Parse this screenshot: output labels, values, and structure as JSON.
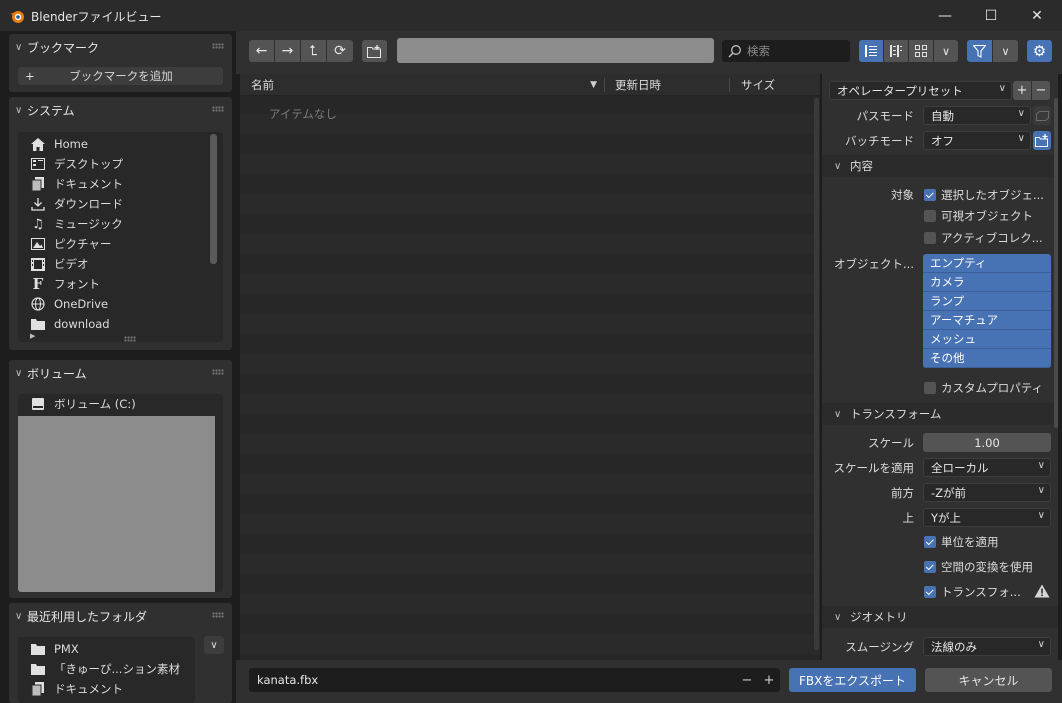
{
  "window": {
    "title": "Blenderファイルビュー",
    "minimize": "—",
    "maximize": "☐",
    "close": "✕"
  },
  "sidebar": {
    "bookmarks": {
      "header": "ブックマーク",
      "add_label": "ブックマークを追加"
    },
    "system": {
      "header": "システム",
      "items": [
        {
          "label": "Home",
          "icon": "home-icon"
        },
        {
          "label": "デスクトップ",
          "icon": "desktop-icon"
        },
        {
          "label": "ドキュメント",
          "icon": "documents-icon"
        },
        {
          "label": "ダウンロード",
          "icon": "download-icon"
        },
        {
          "label": "ミュージック",
          "icon": "music-icon"
        },
        {
          "label": "ピクチャー",
          "icon": "pictures-icon"
        },
        {
          "label": "ビデオ",
          "icon": "video-icon"
        },
        {
          "label": "フォント",
          "icon": "font-icon"
        },
        {
          "label": "OneDrive",
          "icon": "globe-icon"
        },
        {
          "label": "download",
          "icon": "folder-icon"
        }
      ]
    },
    "volumes": {
      "header": "ボリューム",
      "items": [
        {
          "label": "ボリューム (C:)",
          "icon": "disk-icon"
        }
      ]
    },
    "recent": {
      "header": "最近利用したフォルダ",
      "items": [
        {
          "label": "PMX",
          "icon": "folder-icon"
        },
        {
          "label": "「きゅーぴ...ション素材",
          "icon": "folder-icon"
        },
        {
          "label": "ドキュメント",
          "icon": "documents-icon"
        }
      ]
    }
  },
  "toolbar": {
    "path_value": "",
    "search_placeholder": "検索"
  },
  "filelist": {
    "columns": {
      "name": "名前",
      "modified": "更新日時",
      "size": "サイズ"
    },
    "empty_text": "アイテムなし"
  },
  "options": {
    "operator_preset": "オペレータープリセット",
    "path_mode": {
      "label": "パスモード",
      "value": "自動"
    },
    "batch_mode": {
      "label": "バッチモード",
      "value": "オフ"
    },
    "include": {
      "header": "内容",
      "target_label": "対象",
      "selected_objects": "選択したオブジェ...",
      "visible_objects": "可視オブジェクト",
      "active_collection": "アクティブコレク...",
      "object_types_label": "オブジェクト...",
      "object_types": [
        "エンプティ",
        "カメラ",
        "ランプ",
        "アーマチュア",
        "メッシュ",
        "その他"
      ],
      "custom_props": "カスタムプロパティ"
    },
    "transform": {
      "header": "トランスフォーム",
      "scale_label": "スケール",
      "scale_value": "1.00",
      "apply_scale_label": "スケールを適用",
      "apply_scale_value": "全ローカル",
      "forward_label": "前方",
      "forward_value": "-Zが前",
      "up_label": "上",
      "up_value": "Yが上",
      "apply_unit": "単位を適用",
      "use_space_transform": "空間の変換を使用",
      "apply_transform": "トランスフォ..."
    },
    "geometry": {
      "header": "ジオメトリ",
      "smoothing_label": "スムージング",
      "smoothing_value": "法線のみ"
    }
  },
  "bottom": {
    "filename": "kanata.fbx",
    "minus": "−",
    "plus": "+",
    "export_label": "FBXをエクスポート",
    "cancel_label": "キャンセル"
  },
  "colors": {
    "accent": "#4772b3",
    "background": "#1d1d1d",
    "panel": "#303030"
  }
}
